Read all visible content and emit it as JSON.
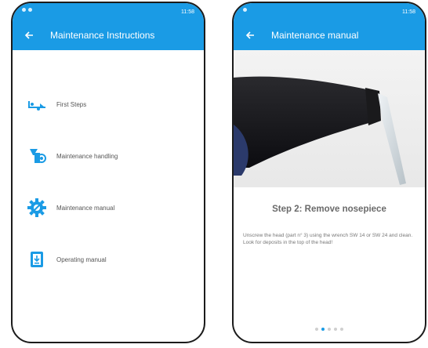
{
  "colors": {
    "accent": "#1a9be5",
    "icon_blue": "#1a9be5",
    "text_grey": "#555555"
  },
  "left_screen": {
    "status_time": "11:58",
    "title": "Maintenance Instructions",
    "menu": [
      {
        "label": "First Steps",
        "icon": "first-steps-icon"
      },
      {
        "label": "Maintenance handling",
        "icon": "maintenance-tool-icon"
      },
      {
        "label": "Maintenance manual",
        "icon": "gear-wrench-icon"
      },
      {
        "label": "Operating manual",
        "icon": "book-download-icon"
      }
    ]
  },
  "right_screen": {
    "status_time": "11:58",
    "title": "Maintenance manual",
    "step_title": "Step 2: Remove nosepiece",
    "step_text": "Unscrew the head (part n° 3) using the wrench SW 14 or SW 24 and clean. Look for deposits in the top of the head!",
    "pager": {
      "count": 5,
      "active_index": 1
    }
  }
}
